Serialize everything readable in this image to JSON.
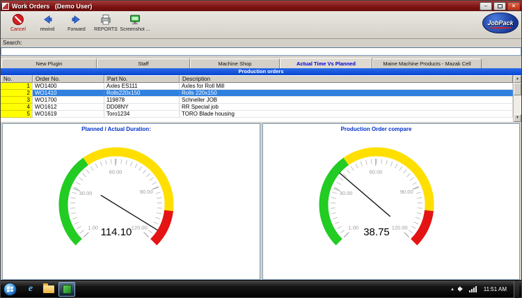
{
  "window": {
    "title": "Work Orders   (Demo User)"
  },
  "icons": {
    "minimize": "–",
    "close": "×",
    "scroll_up": "▲",
    "scroll_down": "▼",
    "tray_arrow": "▴",
    "ie_letter": "e"
  },
  "toolbar": {
    "buttons": [
      {
        "id": "cancel",
        "label": "Cancel"
      },
      {
        "id": "rewind",
        "label": "rewind"
      },
      {
        "id": "forward",
        "label": "Forward"
      },
      {
        "id": "reports",
        "label": "REPORTS"
      },
      {
        "id": "screenshot",
        "label": "Screenshot ..."
      }
    ],
    "logo_text": "JobPack"
  },
  "search": {
    "label": "Search:",
    "value": "",
    "placeholder": ""
  },
  "tabs": [
    {
      "label": "New Plugin",
      "active": false
    },
    {
      "label": "Staff",
      "active": false
    },
    {
      "label": "Machine Shop",
      "active": false
    },
    {
      "label": "Actual Time Vs Planned",
      "active": true
    },
    {
      "label": "Maine Machine Products - Mazak Cell",
      "active": false
    }
  ],
  "table": {
    "title": "Production orders",
    "columns": [
      "No.",
      "Order No.",
      "Part No.",
      "Description"
    ],
    "rows": [
      {
        "no": "1",
        "order": "WO1400",
        "part": "Axles ES111",
        "desc": "Axles for Roll Mill",
        "selected": false
      },
      {
        "no": "2",
        "order": "WO1410",
        "part": "Rolls220x150",
        "desc": "Rolls 220x150",
        "selected": true
      },
      {
        "no": "3",
        "order": "WO1700",
        "part": "119878",
        "desc": "Schneller JOB",
        "selected": false
      },
      {
        "no": "4",
        "order": "WO1612",
        "part": "DD08NY",
        "desc": "RR Special job",
        "selected": false
      },
      {
        "no": "5",
        "order": "WO1619",
        "part": "Toro1234",
        "desc": "TORO Blade housing",
        "selected": false
      }
    ]
  },
  "chart_data": [
    {
      "type": "gauge",
      "title": "Planned / Actual Duration:",
      "value": 114.1,
      "display_value": "114.10",
      "min": 1,
      "max": 120,
      "start_bearing_deg": 225,
      "sweep_deg": 270,
      "tick_values": [
        1,
        30,
        60,
        90,
        120
      ],
      "tick_labels": [
        "1.00",
        "30.00",
        "60.00",
        "90.00",
        "120.00"
      ],
      "zones": [
        {
          "from": 1,
          "to": 45,
          "color": "#22cc22"
        },
        {
          "from": 45,
          "to": 103,
          "color": "#ffdf00"
        },
        {
          "from": 103,
          "to": 120,
          "color": "#e41414"
        }
      ]
    },
    {
      "type": "gauge",
      "title": "Production Order compare",
      "value": 38.75,
      "display_value": "38.75",
      "min": 1,
      "max": 120,
      "start_bearing_deg": 225,
      "sweep_deg": 270,
      "tick_values": [
        1,
        30,
        60,
        90,
        120
      ],
      "tick_labels": [
        "1.00",
        "30.00",
        "60.00",
        "90.00",
        "120.00"
      ],
      "zones": [
        {
          "from": 1,
          "to": 45,
          "color": "#22cc22"
        },
        {
          "from": 45,
          "to": 103,
          "color": "#ffdf00"
        },
        {
          "from": 103,
          "to": 120,
          "color": "#e41414"
        }
      ]
    }
  ],
  "taskbar": {
    "time": "11:51 AM"
  },
  "colors": {
    "titlebar": "#7c1212",
    "accent_blue": "#0846cf",
    "selection": "#2f80df",
    "row_number_bg": "#ffff00",
    "gauge_green": "#22cc22",
    "gauge_yellow": "#ffdf00",
    "gauge_red": "#e41414"
  }
}
